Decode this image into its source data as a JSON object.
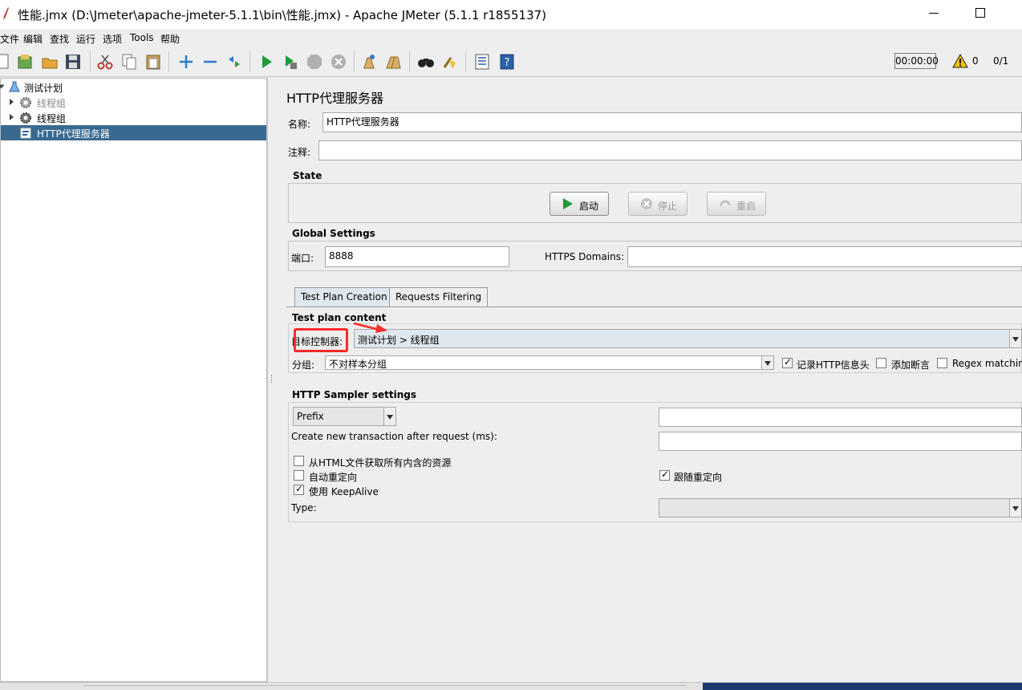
{
  "window": {
    "title": "性能.jmx (D:\\Jmeter\\apache-jmeter-5.1.1\\bin\\性能.jmx) - Apache JMeter (5.1.1 r1855137)"
  },
  "menu": [
    "文件",
    "编辑",
    "查找",
    "运行",
    "选项",
    "Tools",
    "帮助"
  ],
  "toolbar": {
    "icons": [
      "new-icon",
      "templates-icon",
      "open-icon",
      "save-icon",
      "cut-icon",
      "copy-icon",
      "paste-icon",
      "expand-icon",
      "collapse-icon",
      "toggle-icon",
      "start-icon",
      "start-no-pause-icon",
      "stop-icon",
      "shutdown-icon",
      "clear-icon",
      "clear-all-icon",
      "search-icon",
      "reset-search-icon",
      "function-helper-icon",
      "help-icon"
    ],
    "timer": "00:00:00",
    "warning_count": "0",
    "threads": "0/1"
  },
  "tree": {
    "items": [
      {
        "label": "测试计划",
        "level": 0,
        "state": "normal"
      },
      {
        "label": "线程组",
        "level": 1,
        "state": "disabled"
      },
      {
        "label": "线程组",
        "level": 1,
        "state": "normal"
      },
      {
        "label": "HTTP代理服务器",
        "level": 1,
        "state": "selected"
      }
    ]
  },
  "panel": {
    "title": "HTTP代理服务器",
    "name_label": "名称:",
    "name_value": "HTTP代理服务器",
    "comment_label": "注释:",
    "comment_value": "",
    "state_title": "State",
    "start_label": "启动",
    "stop_label": "停止",
    "restart_label": "重启",
    "global_title": "Global Settings",
    "port_label": "端口:",
    "port_value": "8888",
    "https_label": "HTTPS Domains:",
    "https_value": "",
    "tabs": [
      "Test Plan Creation",
      "Requests Filtering"
    ],
    "content_title": "Test plan content",
    "target_label": "目标控制器:",
    "target_value": "测试计划 > 线程组",
    "group_label": "分组:",
    "group_value": "不对样本分组",
    "chk_record_headers": "记录HTTP信息头",
    "chk_add_assertions": "添加断言",
    "chk_regex": "Regex matching",
    "sampler_title": "HTTP Sampler settings",
    "prefix_value": "Prefix",
    "prefix_input": "",
    "transaction_label": "Create new transaction after request (ms):",
    "transaction_value": "",
    "chk_retrieve_resources": "从HTML文件获取所有内含的资源",
    "chk_auto_redirect": "自动重定向",
    "chk_keepalive": "使用 KeepAlive",
    "chk_follow_redirects": "跟随重定向",
    "type_label": "Type:",
    "type_value": ""
  },
  "checks": {
    "record_headers": true,
    "add_assertions": false,
    "regex": false,
    "retrieve_resources": false,
    "auto_redirect": false,
    "keepalive": true,
    "follow_redirects": true
  },
  "colors": {
    "selection": "#39698f",
    "highlight": "#ff2a2a",
    "tab_active": "#dfe7ef"
  }
}
